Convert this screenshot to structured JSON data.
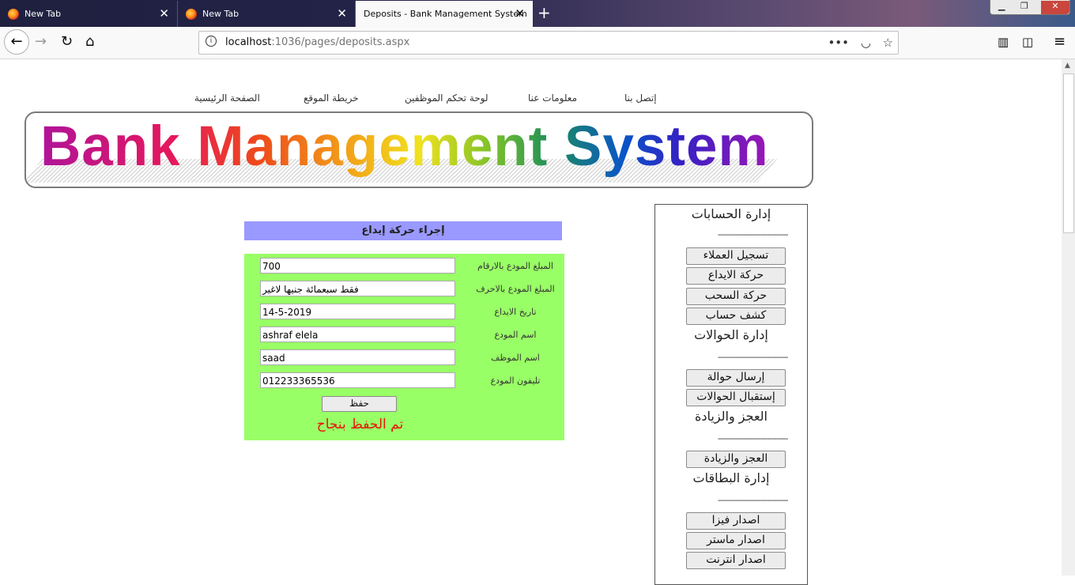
{
  "browser": {
    "tabs": [
      {
        "title": "New Tab"
      },
      {
        "title": "New Tab"
      },
      {
        "title": "Deposits - Bank Management System"
      }
    ],
    "url_host": "localhost",
    "url_rest": ":1036/pages/deposits.aspx"
  },
  "topnav": {
    "contact": "إتصل بنا",
    "about": "معلومات عنا",
    "dashboard": "لوحة تحكم الموظفين",
    "sitemap": "خريطة الموقع",
    "home": "الصفحة الرئيسية"
  },
  "banner": {
    "title": "Bank Management System"
  },
  "sidebar": {
    "dashes": "------------------------------",
    "sections": [
      {
        "title": "إدارة الحسابات",
        "buttons": [
          "تسجيل العملاء",
          "حركة الايداع",
          "حركة السحب",
          "كشف حساب"
        ]
      },
      {
        "title": "إدارة الحوالات",
        "buttons": [
          "إرسال حوالة",
          "إستقبال الحوالات"
        ]
      },
      {
        "title": "العجز والزيادة",
        "buttons": [
          "العجز والزيادة"
        ]
      },
      {
        "title": "إدارة البطاقات",
        "buttons": [
          "اصدار فيزا",
          "اصدار ماستر",
          "اصدار انترنت"
        ]
      }
    ]
  },
  "form": {
    "header": "إجراء حركة إيداع",
    "fields": [
      {
        "label": "المبلغ المودع بالارقام",
        "value": "700"
      },
      {
        "label": "المبلغ المودع بالاحرف",
        "value": "فقط سبعمائة جنيها لاغير"
      },
      {
        "label": "تاريخ الايداع",
        "value": "14-5-2019"
      },
      {
        "label": "اسم المودع",
        "value": "ashraf elela"
      },
      {
        "label": "اسم الموظف",
        "value": "saad"
      },
      {
        "label": "تليفون المودع",
        "value": "012233365536"
      }
    ],
    "save_label": "حفظ",
    "success_message": "تم الحفظ بنجاح"
  }
}
